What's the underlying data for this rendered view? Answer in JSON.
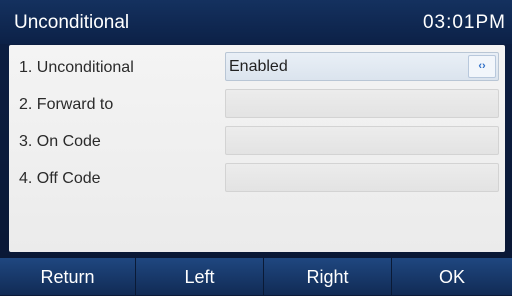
{
  "header": {
    "title": "Unconditional",
    "time": "03:01PM"
  },
  "rows": [
    {
      "label": "1. Unconditional",
      "value": "Enabled",
      "switch_icon": "‹›"
    },
    {
      "label": "2. Forward to",
      "value": ""
    },
    {
      "label": "3. On Code",
      "value": ""
    },
    {
      "label": "4. Off Code",
      "value": ""
    }
  ],
  "softkeys": [
    "Return",
    "Left",
    "Right",
    "OK"
  ],
  "colors": {
    "titlebar": "#14315f",
    "panel": "#f0f0f0",
    "accent": "#2f6fc8"
  }
}
